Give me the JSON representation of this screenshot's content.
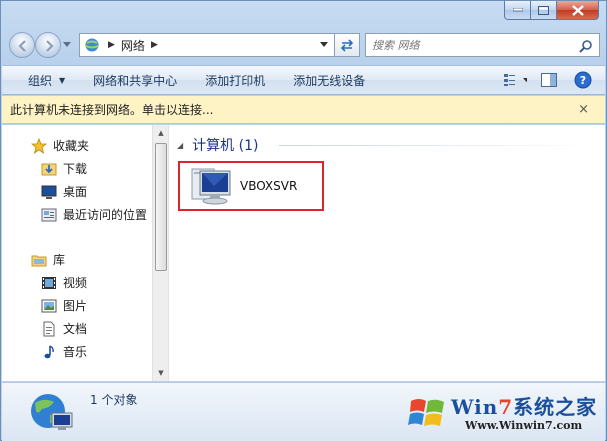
{
  "window": {
    "caption_buttons": [
      "minimize",
      "maximize",
      "close"
    ]
  },
  "nav": {
    "breadcrumb": [
      "网络"
    ],
    "search_placeholder": "搜索 网络"
  },
  "toolbar": {
    "organize": "组织",
    "network_sharing": "网络和共享中心",
    "add_printer": "添加打印机",
    "add_wireless": "添加无线设备"
  },
  "infobar": {
    "text": "此计算机未连接到网络。单击以连接...",
    "close": "×"
  },
  "sidebar": {
    "favorites": {
      "label": "收藏夹",
      "items": [
        {
          "label": "下载",
          "icon": "download-folder-icon"
        },
        {
          "label": "桌面",
          "icon": "desktop-icon"
        },
        {
          "label": "最近访问的位置",
          "icon": "recent-places-icon"
        }
      ]
    },
    "libraries": {
      "label": "库",
      "items": [
        {
          "label": "视频",
          "icon": "video-library-icon"
        },
        {
          "label": "图片",
          "icon": "pictures-library-icon"
        },
        {
          "label": "文档",
          "icon": "documents-library-icon"
        },
        {
          "label": "音乐",
          "icon": "music-library-icon"
        }
      ]
    }
  },
  "content": {
    "group_title": "计算机 (1)",
    "items": [
      {
        "label": "VBOXSVR",
        "icon": "computer-icon"
      }
    ]
  },
  "status": {
    "text": "1 个对象"
  },
  "watermark": {
    "title_win": "Win",
    "title_7": "7",
    "title_rest": "系统之家",
    "url": "Www.Winwin7.com"
  },
  "colors": {
    "group_header": "#1e3287",
    "highlight_border": "#d9252b",
    "infobar_bg": "#fdf3c4"
  }
}
